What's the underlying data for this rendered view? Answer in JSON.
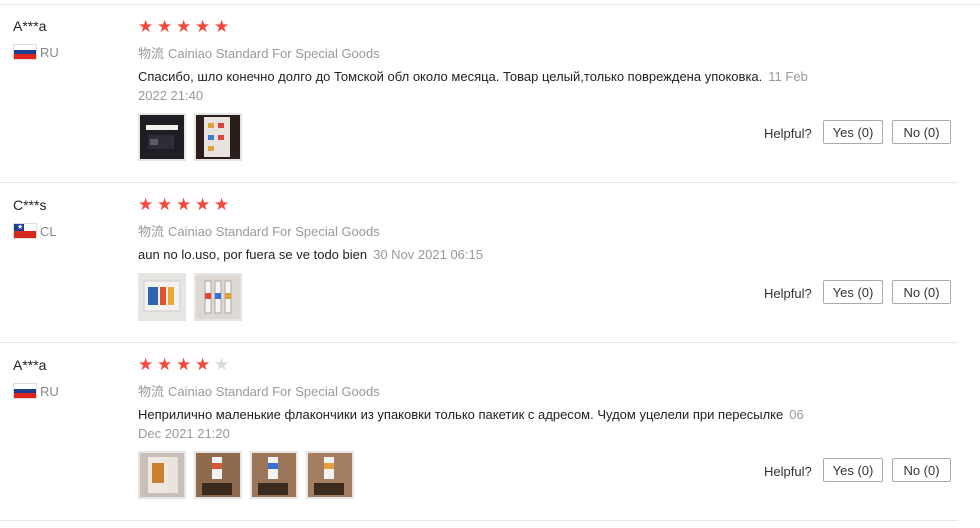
{
  "reviews": [
    {
      "user": "A***a",
      "country": "RU",
      "flag": "ru",
      "rating": 5,
      "shipping_label": "物流",
      "shipping": "Cainiao Standard For Special Goods",
      "text_line1": "Спасибо, шло конечно долго до Томской обл около месяца. Товар целый,только повреждена упоковка.",
      "date_line1": "11 Feb",
      "date_line2": "2022 21:40",
      "helpful_label": "Helpful?",
      "yes_label": "Yes (0)",
      "no_label": "No (0)"
    },
    {
      "user": "C***s",
      "country": "CL",
      "flag": "cl",
      "rating": 5,
      "shipping_label": "物流",
      "shipping": "Cainiao Standard For Special Goods",
      "text_line1": "aun no lo.uso, por fuera se ve todo bien",
      "date_line1": "30 Nov 2021 06:15",
      "date_line2": "",
      "helpful_label": "Helpful?",
      "yes_label": "Yes (0)",
      "no_label": "No (0)"
    },
    {
      "user": "A***a",
      "country": "RU",
      "flag": "ru",
      "rating": 4,
      "shipping_label": "物流",
      "shipping": "Cainiao Standard For Special Goods",
      "text_line1": "Неприлично маленькие флакончики из упаковки только пакетик с адресом. Чудом уцелели при пересылке",
      "date_line1": "06",
      "date_line2": "Dec 2021 21:20",
      "helpful_label": "Helpful?",
      "yes_label": "Yes (0)",
      "no_label": "No (0)"
    }
  ],
  "star_color": "#f5473b"
}
